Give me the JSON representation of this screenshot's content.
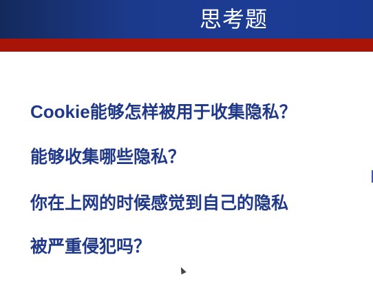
{
  "slide": {
    "title": "思考题",
    "questions": [
      {
        "prefix": "Cookie",
        "text": "能够怎样被用于收集隐私？"
      },
      {
        "text": "能够收集哪些隐私？"
      },
      {
        "text": "你在上网的时候感觉到自己的隐私"
      },
      {
        "text": "被严重侵犯吗？"
      }
    ]
  },
  "colors": {
    "header_blue": "#1c3a8c",
    "accent_red": "#a91408",
    "text_blue": "#1f3888"
  }
}
